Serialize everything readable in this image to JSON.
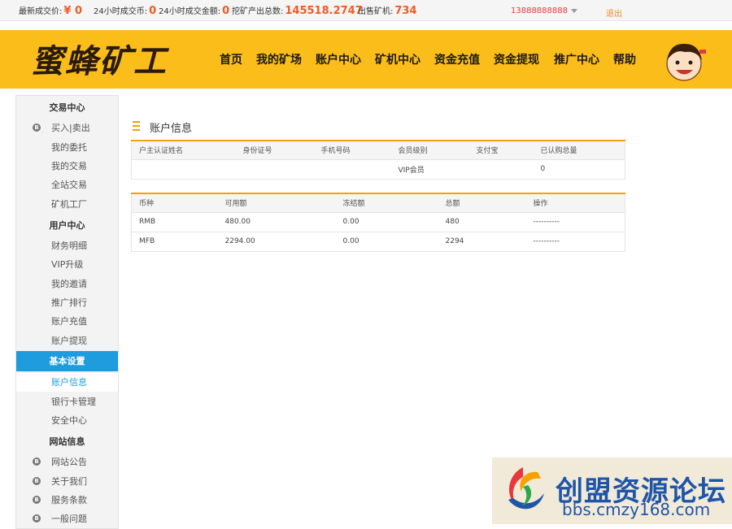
{
  "topbar": {
    "latest_price_label": "最新成交价:",
    "latest_price_value": "¥ 0",
    "coin_volume_label": "24小时成交币:",
    "coin_volume_value": "0",
    "amount_label": "24小时成交金额:",
    "amount_value": "0",
    "mined_label": "挖矿产出总数:",
    "mined_value": "145518.2747",
    "sold_label": "出售矿机:",
    "sold_value": "734",
    "user_phone": "13888888888",
    "logout": "退出"
  },
  "header": {
    "logo_text": "蜜蜂矿工",
    "nav": [
      "首页",
      "我的矿场",
      "账户中心",
      "矿机中心",
      "资金充值",
      "资金提现",
      "推广中心",
      "帮助"
    ],
    "colors": {
      "header_bg": "#fbbd1a",
      "accent": "#f5a100",
      "active_blue": "#1e9cde"
    }
  },
  "sidebar": {
    "groups": [
      {
        "title": "交易中心",
        "items": [
          {
            "label": "买入|卖出",
            "icon": "coin-icon"
          },
          {
            "label": "我的委托"
          },
          {
            "label": "我的交易"
          },
          {
            "label": "全站交易"
          },
          {
            "label": "矿机工厂"
          }
        ]
      },
      {
        "title": "用户中心",
        "items": [
          {
            "label": "财务明细"
          },
          {
            "label": "VIP升级"
          },
          {
            "label": "我的邀请"
          },
          {
            "label": "推广排行"
          },
          {
            "label": "账户充值"
          },
          {
            "label": "账户提现"
          }
        ]
      },
      {
        "title": "基本设置",
        "active": true,
        "items": [
          {
            "label": "账户信息",
            "selected": true
          },
          {
            "label": "银行卡管理"
          },
          {
            "label": "安全中心"
          }
        ]
      },
      {
        "title": "网站信息",
        "items": [
          {
            "label": "网站公告",
            "icon": "coin-icon"
          },
          {
            "label": "关于我们",
            "icon": "coin-icon"
          },
          {
            "label": "服务条款",
            "icon": "coin-icon"
          },
          {
            "label": "一般问题",
            "icon": "coin-icon"
          }
        ]
      }
    ]
  },
  "main": {
    "title": "账户信息",
    "info_table": {
      "headers": [
        "户主认证姓名",
        "身份证号",
        "手机号码",
        "会员级别",
        "支付宝",
        "已认购总量"
      ],
      "rows": [
        [
          "",
          "",
          "",
          "VIP会员",
          "",
          "0"
        ]
      ]
    },
    "balance_table": {
      "headers": [
        "币种",
        "可用额",
        "冻结额",
        "总额",
        "操作"
      ],
      "rows": [
        [
          "RMB",
          "480.00",
          "0.00",
          "480",
          "----------"
        ],
        [
          "MFB",
          "2294.00",
          "0.00",
          "2294",
          "----------"
        ]
      ]
    }
  },
  "watermark": {
    "title": "创盟资源论坛",
    "url": "bbs.cmzy168.com"
  }
}
